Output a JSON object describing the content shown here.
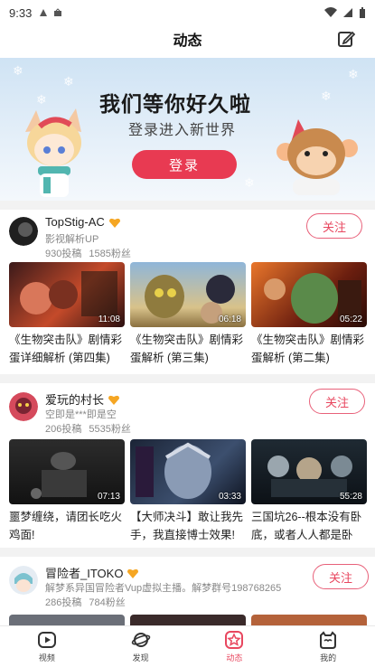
{
  "status_bar": {
    "time": "9:33"
  },
  "header": {
    "title": "动态"
  },
  "banner": {
    "headline": "我们等你好久啦",
    "subline": "登录进入新世界",
    "login_label": "登录"
  },
  "posts": [
    {
      "name": "TopStig-AC",
      "desc": "影视解析UP",
      "posts_count": "930投稿",
      "fans": "1585粉丝",
      "follow_label": "关注",
      "videos": [
        {
          "title": "《生物突击队》剧情彩蛋详细解析 (第四集)",
          "duration": "11:08"
        },
        {
          "title": "《生物突击队》剧情彩蛋解析 (第三集)",
          "duration": "06:18"
        },
        {
          "title": "《生物突击队》剧情彩蛋解析 (第二集)",
          "duration": "05:22"
        }
      ]
    },
    {
      "name": "爱玩的村长",
      "desc": "空即是***即是空",
      "posts_count": "206投稿",
      "fans": "5535粉丝",
      "follow_label": "关注",
      "videos": [
        {
          "title": "噩梦缠绕，请团长吃火鸡面!",
          "duration": "07:13"
        },
        {
          "title": "【大师决斗】敢让我先手，我直接博士效果!",
          "duration": "03:33"
        },
        {
          "title": "三国坑26--根本没有卧底，或者人人都是卧",
          "duration": "55:28"
        }
      ]
    },
    {
      "name": "冒险者_ITOKO",
      "desc": "解梦系异国冒险者Vup虚拟主播。解梦群号198768265",
      "posts_count": "286投稿",
      "fans": "784粉丝",
      "follow_label": "关注"
    }
  ],
  "nav": [
    {
      "label": "视频",
      "icon": "play-icon"
    },
    {
      "label": "发现",
      "icon": "planet-icon"
    },
    {
      "label": "动态",
      "icon": "star-icon",
      "active": true
    },
    {
      "label": "我的",
      "icon": "profile-icon"
    }
  ],
  "colors": {
    "accent": "#e8475f"
  }
}
